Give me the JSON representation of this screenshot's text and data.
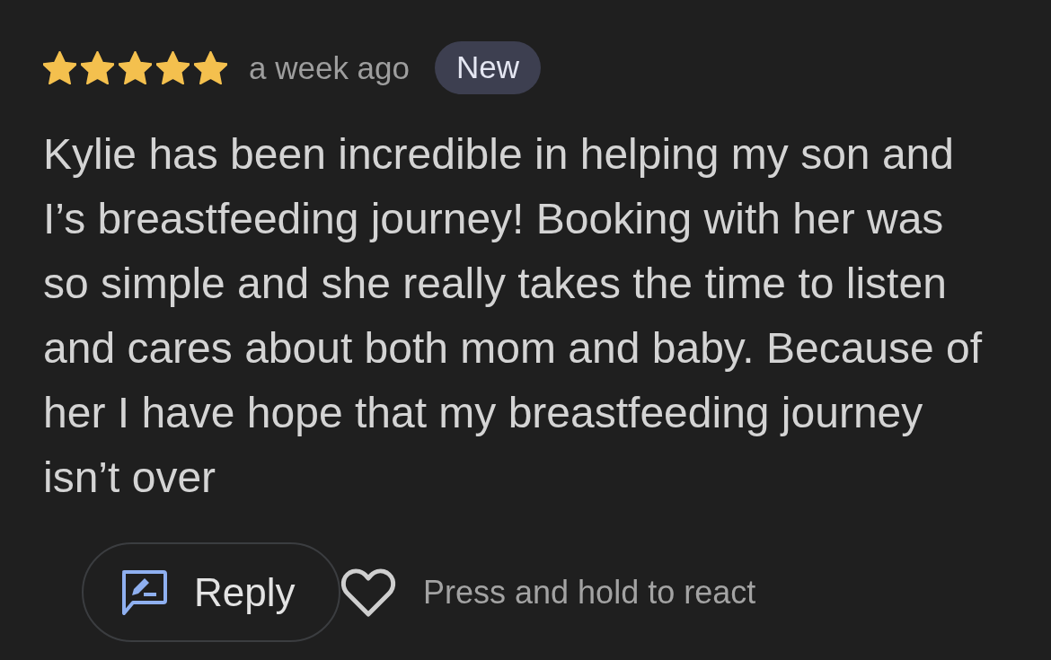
{
  "review": {
    "stars": 5,
    "time": "a week ago",
    "badge": "New",
    "text": "Kylie has been incredible in helping my son and I’s breastfeeding journey! Booking with her was so simple and she really takes the time to listen and cares about both mom and baby. Because of her I have hope that my breastfeeding journey isn’t over",
    "reply_button": "Reply",
    "react_hint": "Press and hold to react"
  }
}
